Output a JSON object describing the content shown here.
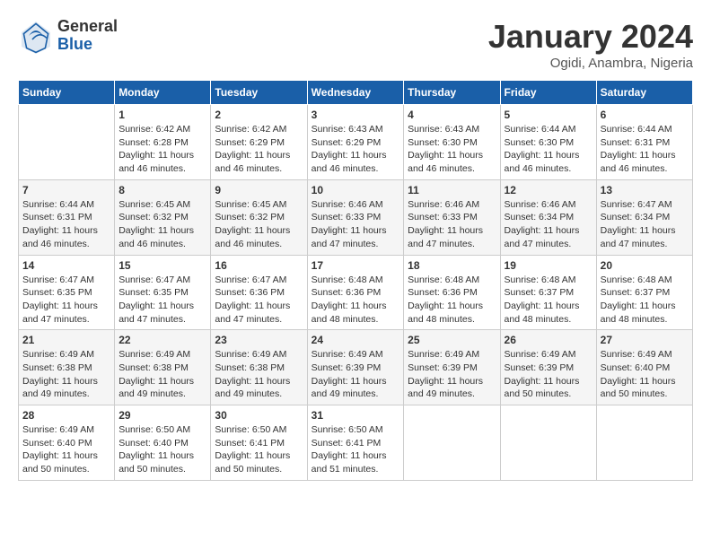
{
  "header": {
    "logo_general": "General",
    "logo_blue": "Blue",
    "month_title": "January 2024",
    "location": "Ogidi, Anambra, Nigeria"
  },
  "columns": [
    "Sunday",
    "Monday",
    "Tuesday",
    "Wednesday",
    "Thursday",
    "Friday",
    "Saturday"
  ],
  "weeks": [
    [
      {
        "day": "",
        "info": ""
      },
      {
        "day": "1",
        "info": "Sunrise: 6:42 AM\nSunset: 6:28 PM\nDaylight: 11 hours and 46 minutes."
      },
      {
        "day": "2",
        "info": "Sunrise: 6:42 AM\nSunset: 6:29 PM\nDaylight: 11 hours and 46 minutes."
      },
      {
        "day": "3",
        "info": "Sunrise: 6:43 AM\nSunset: 6:29 PM\nDaylight: 11 hours and 46 minutes."
      },
      {
        "day": "4",
        "info": "Sunrise: 6:43 AM\nSunset: 6:30 PM\nDaylight: 11 hours and 46 minutes."
      },
      {
        "day": "5",
        "info": "Sunrise: 6:44 AM\nSunset: 6:30 PM\nDaylight: 11 hours and 46 minutes."
      },
      {
        "day": "6",
        "info": "Sunrise: 6:44 AM\nSunset: 6:31 PM\nDaylight: 11 hours and 46 minutes."
      }
    ],
    [
      {
        "day": "7",
        "info": "Sunrise: 6:44 AM\nSunset: 6:31 PM\nDaylight: 11 hours and 46 minutes."
      },
      {
        "day": "8",
        "info": "Sunrise: 6:45 AM\nSunset: 6:32 PM\nDaylight: 11 hours and 46 minutes."
      },
      {
        "day": "9",
        "info": "Sunrise: 6:45 AM\nSunset: 6:32 PM\nDaylight: 11 hours and 46 minutes."
      },
      {
        "day": "10",
        "info": "Sunrise: 6:46 AM\nSunset: 6:33 PM\nDaylight: 11 hours and 47 minutes."
      },
      {
        "day": "11",
        "info": "Sunrise: 6:46 AM\nSunset: 6:33 PM\nDaylight: 11 hours and 47 minutes."
      },
      {
        "day": "12",
        "info": "Sunrise: 6:46 AM\nSunset: 6:34 PM\nDaylight: 11 hours and 47 minutes."
      },
      {
        "day": "13",
        "info": "Sunrise: 6:47 AM\nSunset: 6:34 PM\nDaylight: 11 hours and 47 minutes."
      }
    ],
    [
      {
        "day": "14",
        "info": "Sunrise: 6:47 AM\nSunset: 6:35 PM\nDaylight: 11 hours and 47 minutes."
      },
      {
        "day": "15",
        "info": "Sunrise: 6:47 AM\nSunset: 6:35 PM\nDaylight: 11 hours and 47 minutes."
      },
      {
        "day": "16",
        "info": "Sunrise: 6:47 AM\nSunset: 6:36 PM\nDaylight: 11 hours and 47 minutes."
      },
      {
        "day": "17",
        "info": "Sunrise: 6:48 AM\nSunset: 6:36 PM\nDaylight: 11 hours and 48 minutes."
      },
      {
        "day": "18",
        "info": "Sunrise: 6:48 AM\nSunset: 6:36 PM\nDaylight: 11 hours and 48 minutes."
      },
      {
        "day": "19",
        "info": "Sunrise: 6:48 AM\nSunset: 6:37 PM\nDaylight: 11 hours and 48 minutes."
      },
      {
        "day": "20",
        "info": "Sunrise: 6:48 AM\nSunset: 6:37 PM\nDaylight: 11 hours and 48 minutes."
      }
    ],
    [
      {
        "day": "21",
        "info": "Sunrise: 6:49 AM\nSunset: 6:38 PM\nDaylight: 11 hours and 49 minutes."
      },
      {
        "day": "22",
        "info": "Sunrise: 6:49 AM\nSunset: 6:38 PM\nDaylight: 11 hours and 49 minutes."
      },
      {
        "day": "23",
        "info": "Sunrise: 6:49 AM\nSunset: 6:38 PM\nDaylight: 11 hours and 49 minutes."
      },
      {
        "day": "24",
        "info": "Sunrise: 6:49 AM\nSunset: 6:39 PM\nDaylight: 11 hours and 49 minutes."
      },
      {
        "day": "25",
        "info": "Sunrise: 6:49 AM\nSunset: 6:39 PM\nDaylight: 11 hours and 49 minutes."
      },
      {
        "day": "26",
        "info": "Sunrise: 6:49 AM\nSunset: 6:39 PM\nDaylight: 11 hours and 50 minutes."
      },
      {
        "day": "27",
        "info": "Sunrise: 6:49 AM\nSunset: 6:40 PM\nDaylight: 11 hours and 50 minutes."
      }
    ],
    [
      {
        "day": "28",
        "info": "Sunrise: 6:49 AM\nSunset: 6:40 PM\nDaylight: 11 hours and 50 minutes."
      },
      {
        "day": "29",
        "info": "Sunrise: 6:50 AM\nSunset: 6:40 PM\nDaylight: 11 hours and 50 minutes."
      },
      {
        "day": "30",
        "info": "Sunrise: 6:50 AM\nSunset: 6:41 PM\nDaylight: 11 hours and 50 minutes."
      },
      {
        "day": "31",
        "info": "Sunrise: 6:50 AM\nSunset: 6:41 PM\nDaylight: 11 hours and 51 minutes."
      },
      {
        "day": "",
        "info": ""
      },
      {
        "day": "",
        "info": ""
      },
      {
        "day": "",
        "info": ""
      }
    ]
  ]
}
